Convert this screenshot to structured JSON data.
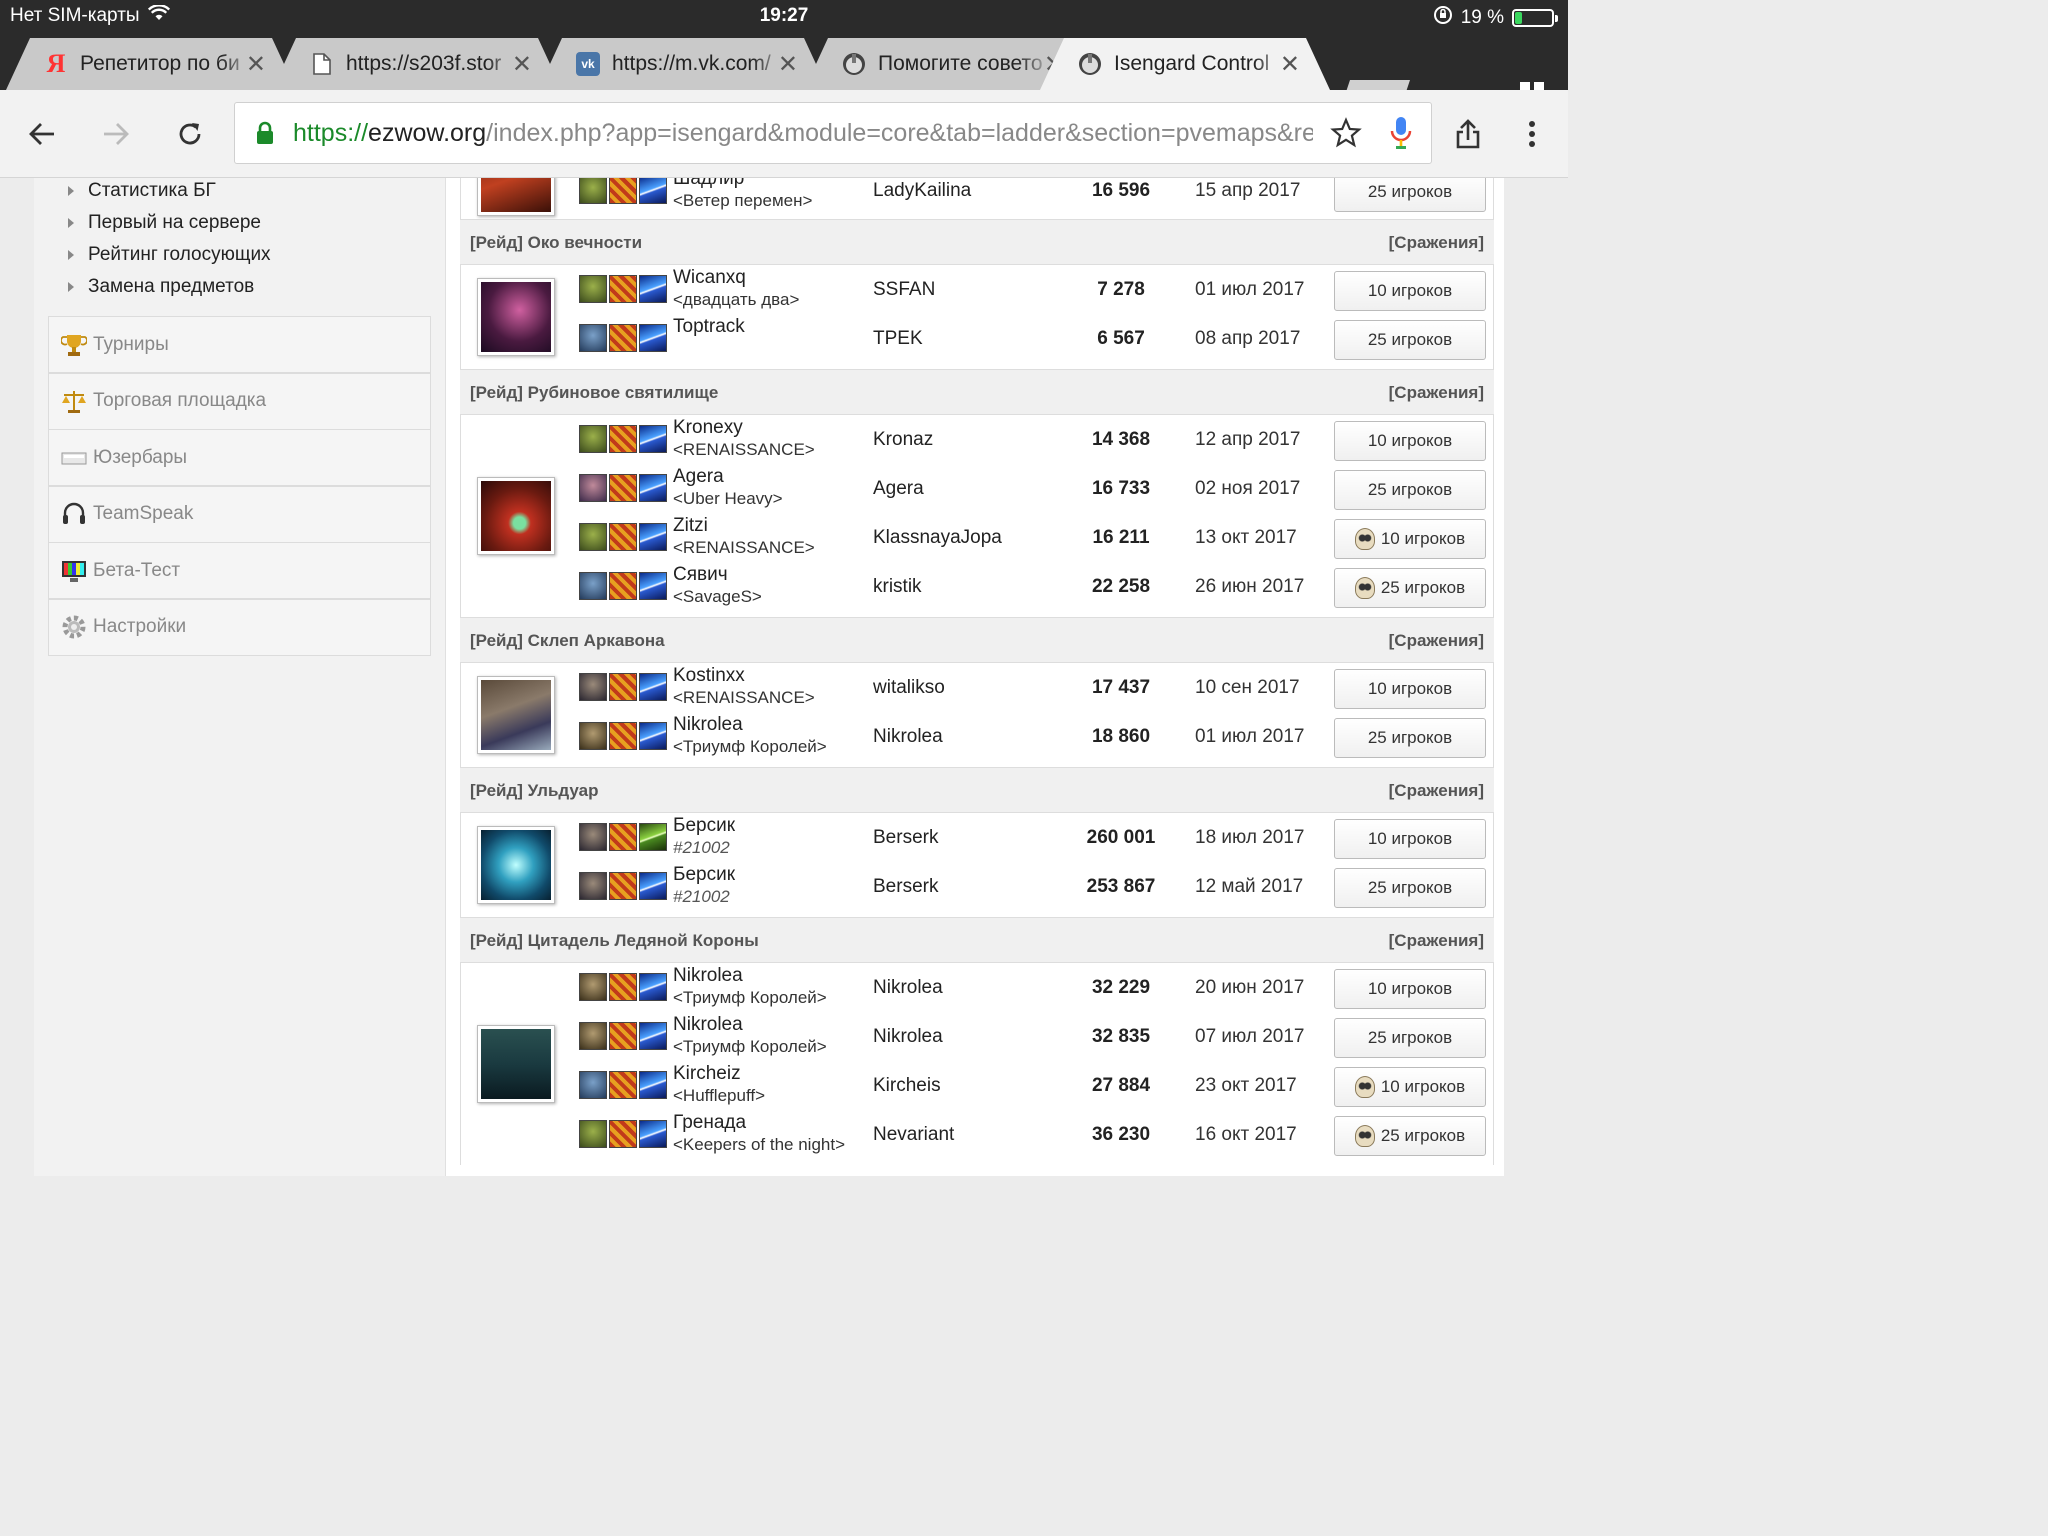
{
  "status_bar": {
    "carrier": "Нет SIM-карты",
    "time": "19:27",
    "battery": "19 %",
    "battery_level": 0.19
  },
  "tabs": [
    {
      "title": "Репетитор по би",
      "icon": "yandex-icon"
    },
    {
      "title": "https://s203f.stor",
      "icon": "page-icon"
    },
    {
      "title": "https://m.vk.com/",
      "icon": "vk-icon"
    },
    {
      "title": "Помогите совето",
      "icon": "site-icon"
    },
    {
      "title": "Isengard Control",
      "icon": "site-icon",
      "active": true
    }
  ],
  "address_bar": {
    "scheme": "https://",
    "host": "ezwow.org",
    "path": "/index.php?app=isengard&module=core&tab=ladder&section=pvemaps&rea"
  },
  "sidebar": {
    "sub_items": [
      "Статистика БГ",
      "Первый на сервере",
      "Рейтинг голосующих",
      "Замена предметов"
    ],
    "menu": [
      {
        "label": "Турниры",
        "icon": "trophy-icon"
      },
      {
        "label": "Торговая площадка",
        "icon": "scales-icon"
      },
      {
        "label": "Юзербары",
        "icon": "userbar-icon"
      },
      {
        "label": "TeamSpeak",
        "icon": "headset-icon"
      },
      {
        "label": "Бета-Тест",
        "icon": "monitor-icon"
      },
      {
        "label": "Настройки",
        "icon": "gear-icon"
      }
    ]
  },
  "ladder": {
    "top_row": {
      "name": "Шадлир",
      "guild": "<Ветер перемен>",
      "account": "LadyKailina",
      "score": "16 596",
      "date": "15 апр 2017",
      "button": "25 игроков",
      "icons": [
        "orc",
        "war",
        "shm"
      ]
    },
    "sections": [
      {
        "title": "[Рейд] Око вечности",
        "link": "[Сражения]",
        "map": "eye",
        "rows": [
          {
            "name": "Wicanxq",
            "guild": "<двадцать два>",
            "account": "SSFAN",
            "score": "7 278",
            "date": "01 июл 2017",
            "button": "10 игроков",
            "heroic": false,
            "icons": [
              "orc",
              "war",
              "shm"
            ]
          },
          {
            "name": "Toptrack",
            "guild": "",
            "account": "TPEK",
            "score": "6 567",
            "date": "08 апр 2017",
            "button": "25 игроков",
            "heroic": false,
            "icons": [
              "troll",
              "war",
              "shm"
            ]
          }
        ]
      },
      {
        "title": "[Рейд] Рубиновое святилище",
        "link": "[Сражения]",
        "map": "ruby",
        "rows": [
          {
            "name": "Kronexy",
            "guild": "<RENAISSANCE>",
            "account": "Kronaz",
            "score": "14 368",
            "date": "12 апр 2017",
            "button": "10 игроков",
            "heroic": false,
            "icons": [
              "orc",
              "war",
              "shm"
            ]
          },
          {
            "name": "Agera",
            "guild": "<Uber Heavy>",
            "account": "Agera",
            "score": "16 733",
            "date": "02 ноя 2017",
            "button": "25 игроков",
            "heroic": false,
            "icons": [
              "blood",
              "war",
              "shm"
            ]
          },
          {
            "name": "Zitzi",
            "guild": "<RENAISSANCE>",
            "account": "KlassnayaJopa",
            "score": "16 211",
            "date": "13 окт 2017",
            "button": "10 игроков",
            "heroic": true,
            "icons": [
              "orc",
              "war",
              "shm"
            ]
          },
          {
            "name": "Сявич",
            "guild": "<SavageS>",
            "account": "kristik",
            "score": "22 258",
            "date": "26 июн 2017",
            "button": "25 игроков",
            "heroic": true,
            "icons": [
              "troll",
              "war",
              "shm"
            ]
          }
        ]
      },
      {
        "title": "[Рейд] Склеп Аркавона",
        "link": "[Сражения]",
        "map": "vault",
        "rows": [
          {
            "name": "Kostinxx",
            "guild": "<RENAISSANCE>",
            "account": "witalikso",
            "score": "17 437",
            "date": "10 сен 2017",
            "button": "10 игроков",
            "heroic": false,
            "icons": [
              "und",
              "war",
              "shm"
            ]
          },
          {
            "name": "Nikrolea",
            "guild": "<Триумф Королей>",
            "account": "Nikrolea",
            "score": "18 860",
            "date": "01 июл 2017",
            "button": "25 игроков",
            "heroic": false,
            "icons": [
              "tauren",
              "war",
              "shm"
            ]
          }
        ]
      },
      {
        "title": "[Рейд] Ульдуар",
        "link": "[Сражения]",
        "map": "ulduar",
        "rows": [
          {
            "name": "Берсик",
            "guild": "#21002",
            "guild_is_id": true,
            "account": "Berserk",
            "score": "260 001",
            "date": "18 июл 2017",
            "button": "10 игроков",
            "heroic": false,
            "icons": [
              "und",
              "war",
              "hunt"
            ]
          },
          {
            "name": "Берсик",
            "guild": "#21002",
            "guild_is_id": true,
            "account": "Berserk",
            "score": "253 867",
            "date": "12 май 2017",
            "button": "25 игроков",
            "heroic": false,
            "icons": [
              "und",
              "war",
              "shm"
            ]
          }
        ]
      },
      {
        "title": "[Рейд] Цитадель Ледяной Короны",
        "link": "[Сражения]",
        "map": "icc",
        "rows": [
          {
            "name": "Nikrolea",
            "guild": "<Триумф Королей>",
            "account": "Nikrolea",
            "score": "32 229",
            "date": "20 июн 2017",
            "button": "10 игроков",
            "heroic": false,
            "icons": [
              "tauren",
              "war",
              "shm"
            ]
          },
          {
            "name": "Nikrolea",
            "guild": "<Триумф Королей>",
            "account": "Nikrolea",
            "score": "32 835",
            "date": "07 июл 2017",
            "button": "25 игроков",
            "heroic": false,
            "icons": [
              "tauren",
              "war",
              "shm"
            ]
          },
          {
            "name": "Kircheiz",
            "guild": "<Hufflepuff>",
            "account": "Kircheis",
            "score": "27 884",
            "date": "23 окт 2017",
            "button": "10 игроков",
            "heroic": true,
            "icons": [
              "troll",
              "war",
              "shm"
            ]
          },
          {
            "name": "Гренада",
            "guild": "<Keepers of the night>",
            "account": "Nevariant",
            "score": "36 230",
            "date": "16 окт 2017",
            "button": "25 игроков",
            "heroic": true,
            "icons": [
              "orc",
              "war",
              "shm"
            ]
          }
        ]
      }
    ]
  }
}
